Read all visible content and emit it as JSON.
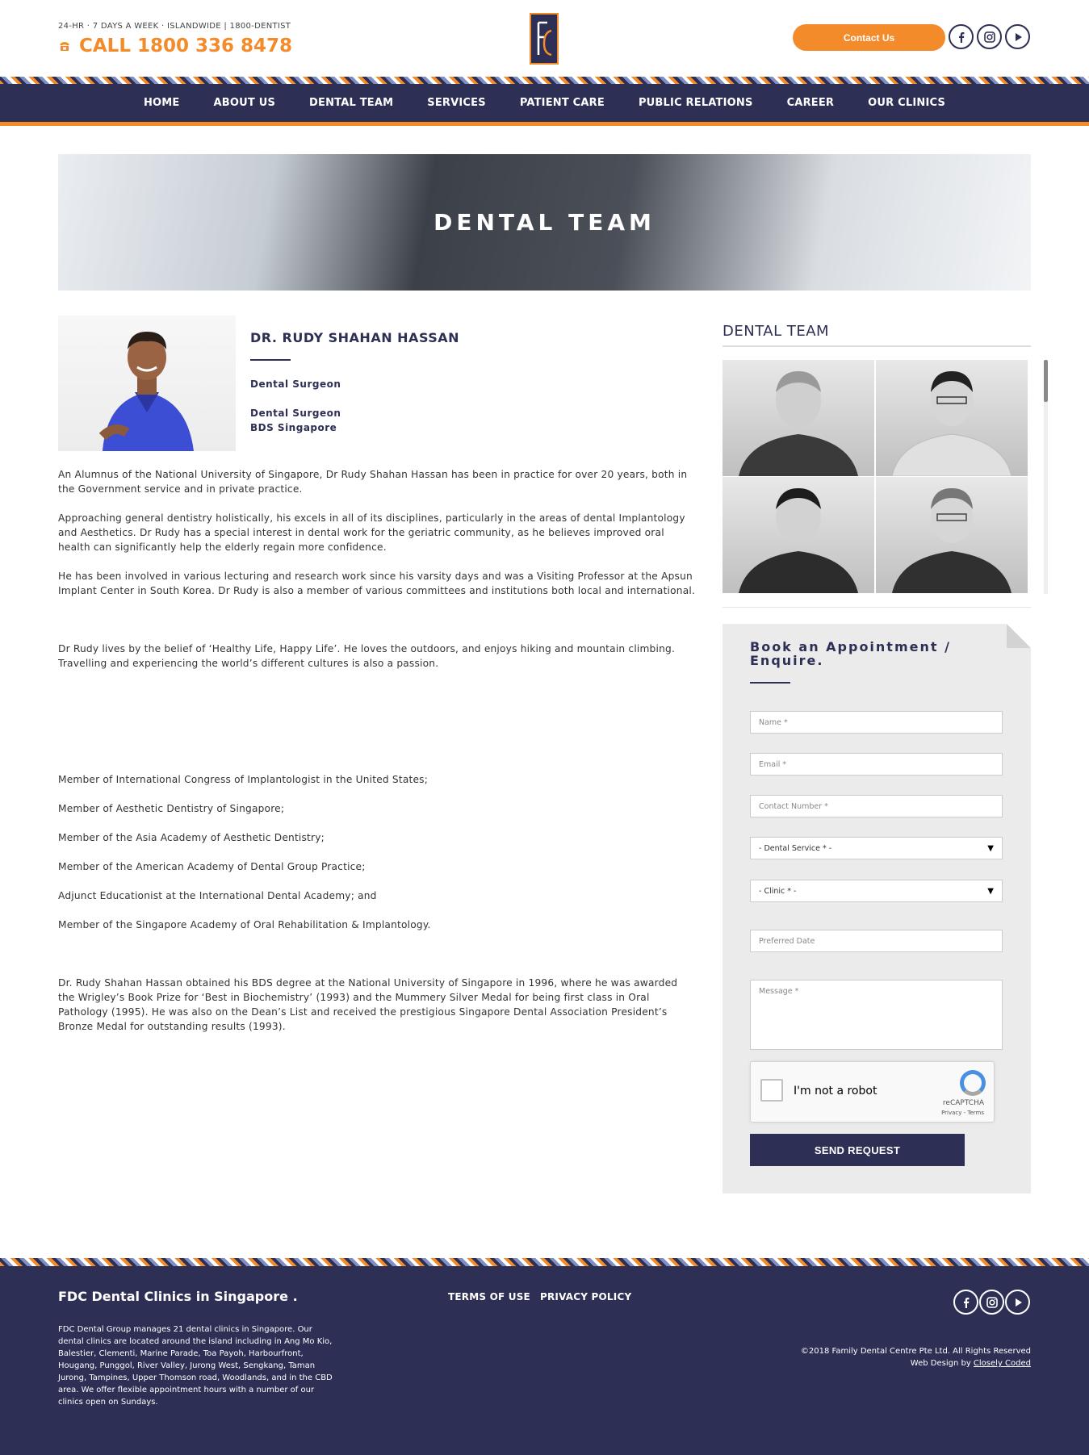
{
  "header": {
    "topline": "24-HR · 7 DAYS A WEEK · ISLANDWIDE | 1800-DENTIST",
    "call": "CALL 1800 336 8478",
    "contact_button": "Contact Us",
    "social_icons": [
      "facebook-icon",
      "instagram-icon",
      "youtube-icon"
    ]
  },
  "nav": {
    "items": [
      "HOME",
      "ABOUT US",
      "DENTAL TEAM",
      "SERVICES",
      "PATIENT CARE",
      "PUBLIC RELATIONS",
      "CAREER",
      "OUR CLINICS"
    ]
  },
  "hero": {
    "title": "DENTAL TEAM"
  },
  "doctor": {
    "name": "DR. RUDY SHAHAN HASSAN",
    "role1": "Dental Surgeon",
    "role2": "Dental Surgeon",
    "degree": "BDS Singapore"
  },
  "bio": {
    "p1": "An Alumnus of the National University of Singapore, Dr Rudy Shahan Hassan has been in practice for over 20 years, both in the Government service and in private practice.",
    "p2": "Approaching general dentistry holistically, his excels in all of its disciplines, particularly in the areas of dental Implantology and Aesthetics. Dr Rudy has a special interest in dental work for the geriatric community, as he believes improved oral health can significantly help the elderly regain more confidence.",
    "p3": "He has been involved in various lecturing and research work since his varsity days and was a Visiting Professor at the Apsun Implant Center in South Korea. Dr Rudy is also a member of various committees and institutions both local and international.",
    "p4": "Dr Rudy lives by the belief of ‘Healthy Life, Happy Life’.  He loves the outdoors, and enjoys hiking and mountain climbing. Travelling and experiencing the world’s different cultures is also a passion.",
    "memberships": [
      "Member of International Congress of Implantologist in the United States;",
      "Member of  Aesthetic Dentistry of Singapore;",
      "Member of  the Asia Academy of Aesthetic Dentistry;",
      "Member of the American Academy of Dental Group Practice;",
      "Adjunct Educationist at the International Dental Academy; and",
      "Member of the Singapore Academy of Oral Rehabilitation & Implantology."
    ],
    "p5": "Dr. Rudy Shahan Hassan obtained his BDS degree at the National University of Singapore in 1996, where he was awarded the Wrigley’s Book Prize for ‘Best in Biochemistry’ (1993) and the Mummery Silver Medal for being first class in Oral Pathology (1995). He was also on the Dean’s List and received the prestigious Singapore Dental Association President’s Bronze Medal for outstanding results (1993)."
  },
  "sidebar": {
    "title": "DENTAL TEAM"
  },
  "form": {
    "title": "Book an Appointment / Enquire.",
    "name_placeholder": "Name *",
    "email_placeholder": "Email *",
    "contact_placeholder": "Contact Number *",
    "service_select": "- Dental Service * -",
    "clinic_select": "- Clinic * -",
    "date_placeholder": "Preferred Date",
    "message_placeholder": "Message *",
    "captcha_label": "I'm not a robot",
    "captcha_brand": "reCAPTCHA",
    "captcha_links": "Privacy - Terms",
    "submit": "SEND REQUEST"
  },
  "footer": {
    "title": "FDC Dental Clinics in Singapore .",
    "text": "FDC Dental Group manages 21 dental clinics in Singapore. Our dental clinics are located around the island including in Ang Mo Kio, Balestier, Clementi, Marine Parade, Toa Payoh, Harbourfront, Hougang, Punggol, River Valley, Jurong West, Sengkang, Taman Jurong, Tampines, Upper Thomson road, Woodlands, and in the CBD area. We offer flexible appointment hours with a number of our clinics open on Sundays.",
    "terms": "TERMS OF USE",
    "privacy": "PRIVACY POLICY",
    "copyright": "©2018 Family Dental Centre Pte Ltd. All Rights Reserved",
    "credit_prefix": "Web Design by",
    "credit_link": "Closely Coded"
  },
  "colors": {
    "navy": "#2d2f54",
    "orange": "#f38b2a"
  }
}
